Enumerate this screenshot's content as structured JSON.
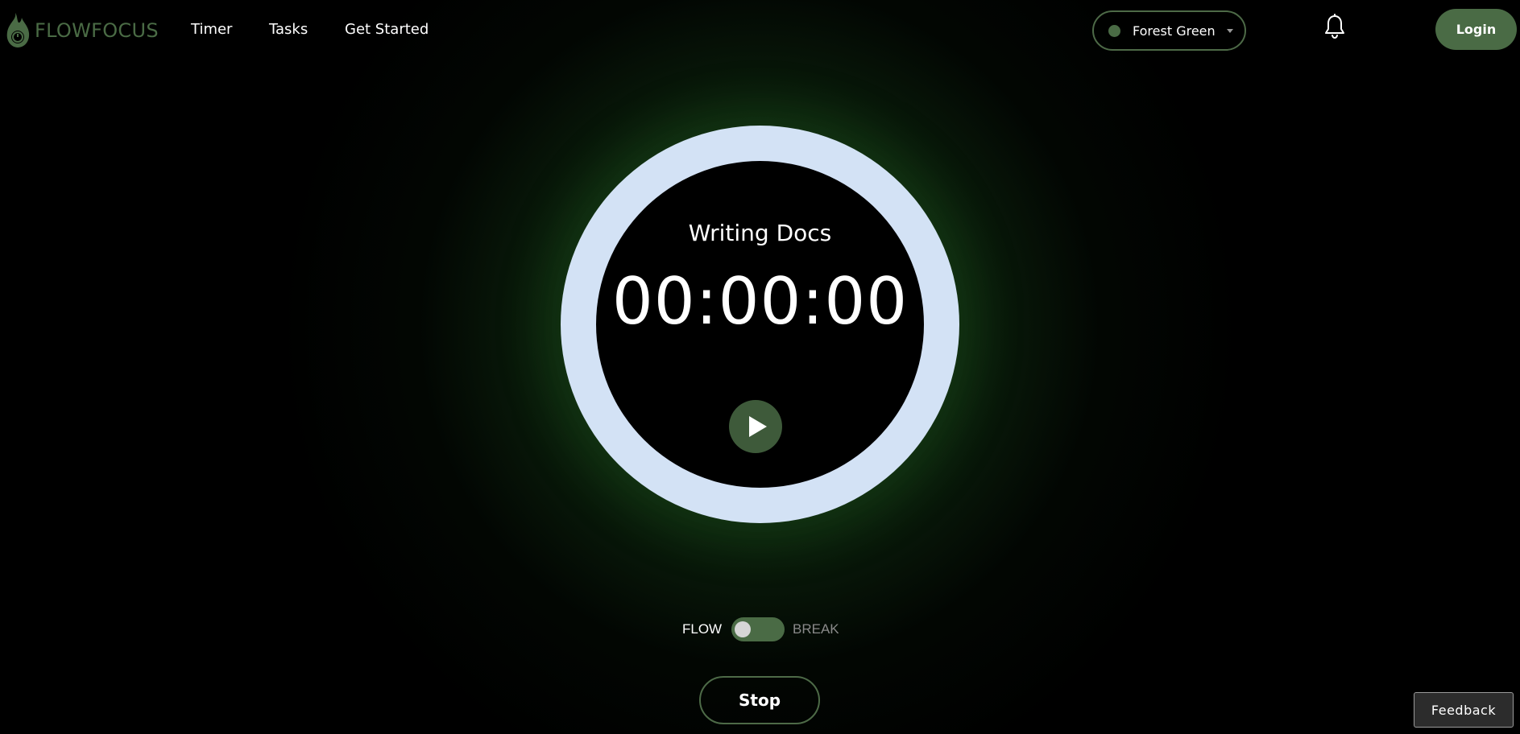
{
  "brand": {
    "name": "FLOWFOCUS",
    "logo_icon": "flame-clock-icon",
    "color": "#4a6b45"
  },
  "nav": {
    "links": [
      "Timer",
      "Tasks",
      "Get Started"
    ]
  },
  "theme_select": {
    "selected": "Forest Green",
    "swatch_color": "#4a6b45"
  },
  "notifications": {
    "icon": "bell-icon"
  },
  "auth": {
    "login_label": "Login"
  },
  "timer": {
    "task_name": "Writing Docs",
    "time": "00:00:00",
    "ring_color": "#d3e2f5",
    "play_icon": "play-icon",
    "play_button_color": "#3e5a3a"
  },
  "mode": {
    "flow_label": "FLOW",
    "break_label": "BREAK",
    "active": "FLOW"
  },
  "controls": {
    "stop_label": "Stop"
  },
  "feedback": {
    "label": "Feedback"
  },
  "colors": {
    "accent": "#4a6b45",
    "background": "#000000",
    "glow": "#2a7a2a"
  }
}
